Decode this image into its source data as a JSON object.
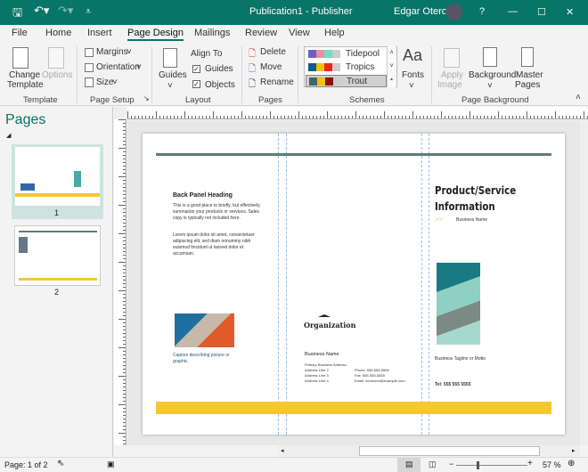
{
  "window": {
    "title": "Publication1  -  Publisher",
    "user": "Edgar Otero",
    "help": "?"
  },
  "tabs": [
    "File",
    "Home",
    "Insert",
    "Page Design",
    "Mailings",
    "Review",
    "View",
    "Help"
  ],
  "ribbon": {
    "template": {
      "change": "Change",
      "change2": "Template",
      "options": "Options",
      "group": "Template"
    },
    "page_setup": {
      "margins": "Margins",
      "orientation": "Orientation",
      "size": "Size",
      "group": "Page Setup"
    },
    "layout": {
      "guides_btn": "Guides",
      "align_to": "Align To",
      "guides": "Guides",
      "objects": "Objects",
      "group": "Layout",
      "guides_checked": true,
      "objects_checked": true
    },
    "pages": {
      "delete": "Delete",
      "move": "Move",
      "rename": "Rename",
      "group": "Pages"
    },
    "schemes": {
      "items": [
        {
          "name": "Tidepool",
          "colors": [
            "#6a62c0",
            "#f08ca0",
            "#6de0c4",
            "#cccccc"
          ]
        },
        {
          "name": "Tropics",
          "colors": [
            "#0d5a8c",
            "#f2c200",
            "#e8261c",
            "#cccccc"
          ]
        },
        {
          "name": "Trout",
          "colors": [
            "#3d6a64",
            "#f2c200",
            "#8c1010",
            "#cccccc"
          ],
          "selected": true
        }
      ],
      "fonts_glyph": "Aa",
      "fonts": "Fonts",
      "group": "Schemes"
    },
    "page_background": {
      "apply": "Apply",
      "apply2": "Image",
      "background": "Background",
      "master": "Master",
      "master2": "Pages",
      "group": "Page Background"
    }
  },
  "pages_pane": {
    "title": "Pages",
    "thumbs": [
      "1",
      "2"
    ]
  },
  "document": {
    "back_heading": "Back Panel Heading",
    "back_p1": "This is a good place to briefly, but effectively, summarize your products or services. Sales copy is typically not included here.",
    "back_p2": "Lorem ipsum dolor sit amet, consectetuer adipiscing elit, sed diam nonummy nibh euismod tincidunt ut laoreet dolor et accumsan.",
    "caption": "Caption describing picture or graphic.",
    "org": "Organization",
    "biz_name": "Business Name",
    "addr": [
      "Primary Business Address",
      "Address Line 2",
      "Address Line 3",
      "Address Line 4"
    ],
    "contact": [
      "Phone: 555-555-5555",
      "Fax: 555-555-5555",
      "Email: someone@example.com"
    ],
    "title": "Product/Service Information",
    "arrows": ">>",
    "biz_name2": "Business Name",
    "tagline": "Business Tagline or Motto",
    "tel": "Tel: 555 555 5555"
  },
  "status": {
    "page": "Page: 1 of 2",
    "zoom": "57 %",
    "minus": "−",
    "plus": "+"
  },
  "colors": {
    "accent": "#077568",
    "bar": "#f5c832",
    "rule": "#5e7b78"
  }
}
